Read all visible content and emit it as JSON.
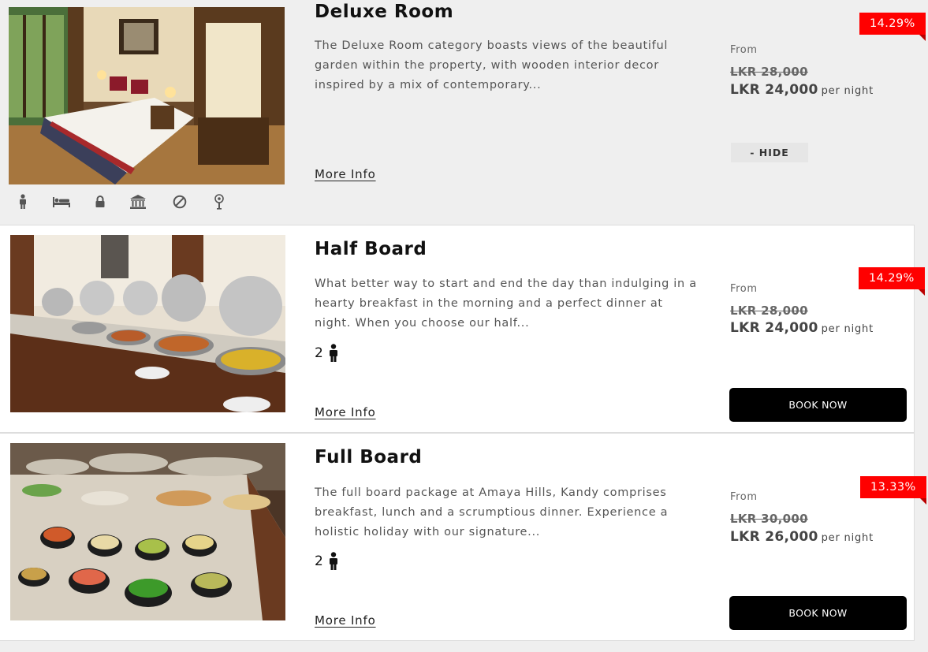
{
  "rooms": [
    {
      "title": "Deluxe Room",
      "description": "The Deluxe Room category boasts views of the beautiful garden within the property, with wooden interior decor inspired by a mix of contemporary...",
      "more_info": "More Info",
      "from_label": "From",
      "old_price": "LKR 28,000",
      "price": "LKR 24,000",
      "per_night": "per night",
      "discount": "14.29%",
      "action_label": "- HIDE",
      "amenities": [
        "person-icon",
        "bed-icon",
        "lock-icon",
        "bank-icon",
        "no-smoking-icon",
        "hair-dryer-icon"
      ]
    },
    {
      "title": "Half Board",
      "description": "What better way to start and end the day than indulging in a hearty breakfast in the morning and a perfect dinner at night. When you choose our half...",
      "guests": "2",
      "more_info": "More Info",
      "from_label": "From",
      "old_price": "LKR 28,000",
      "price": "LKR 24,000",
      "per_night": "per night",
      "discount": "14.29%",
      "action_label": "BOOK NOW"
    },
    {
      "title": "Full Board",
      "description": "The full board package at Amaya Hills, Kandy comprises breakfast, lunch and a scrumptious dinner. Experience a holistic holiday with our signature...",
      "guests": "2",
      "more_info": "More Info",
      "from_label": "From",
      "old_price": "LKR 30,000",
      "price": "LKR 26,000",
      "per_night": "per night",
      "discount": "13.33%",
      "action_label": "BOOK NOW"
    }
  ],
  "colors": {
    "discount_badge": "#ff0000",
    "book_button": "#000000",
    "page_bg": "#efefef"
  }
}
